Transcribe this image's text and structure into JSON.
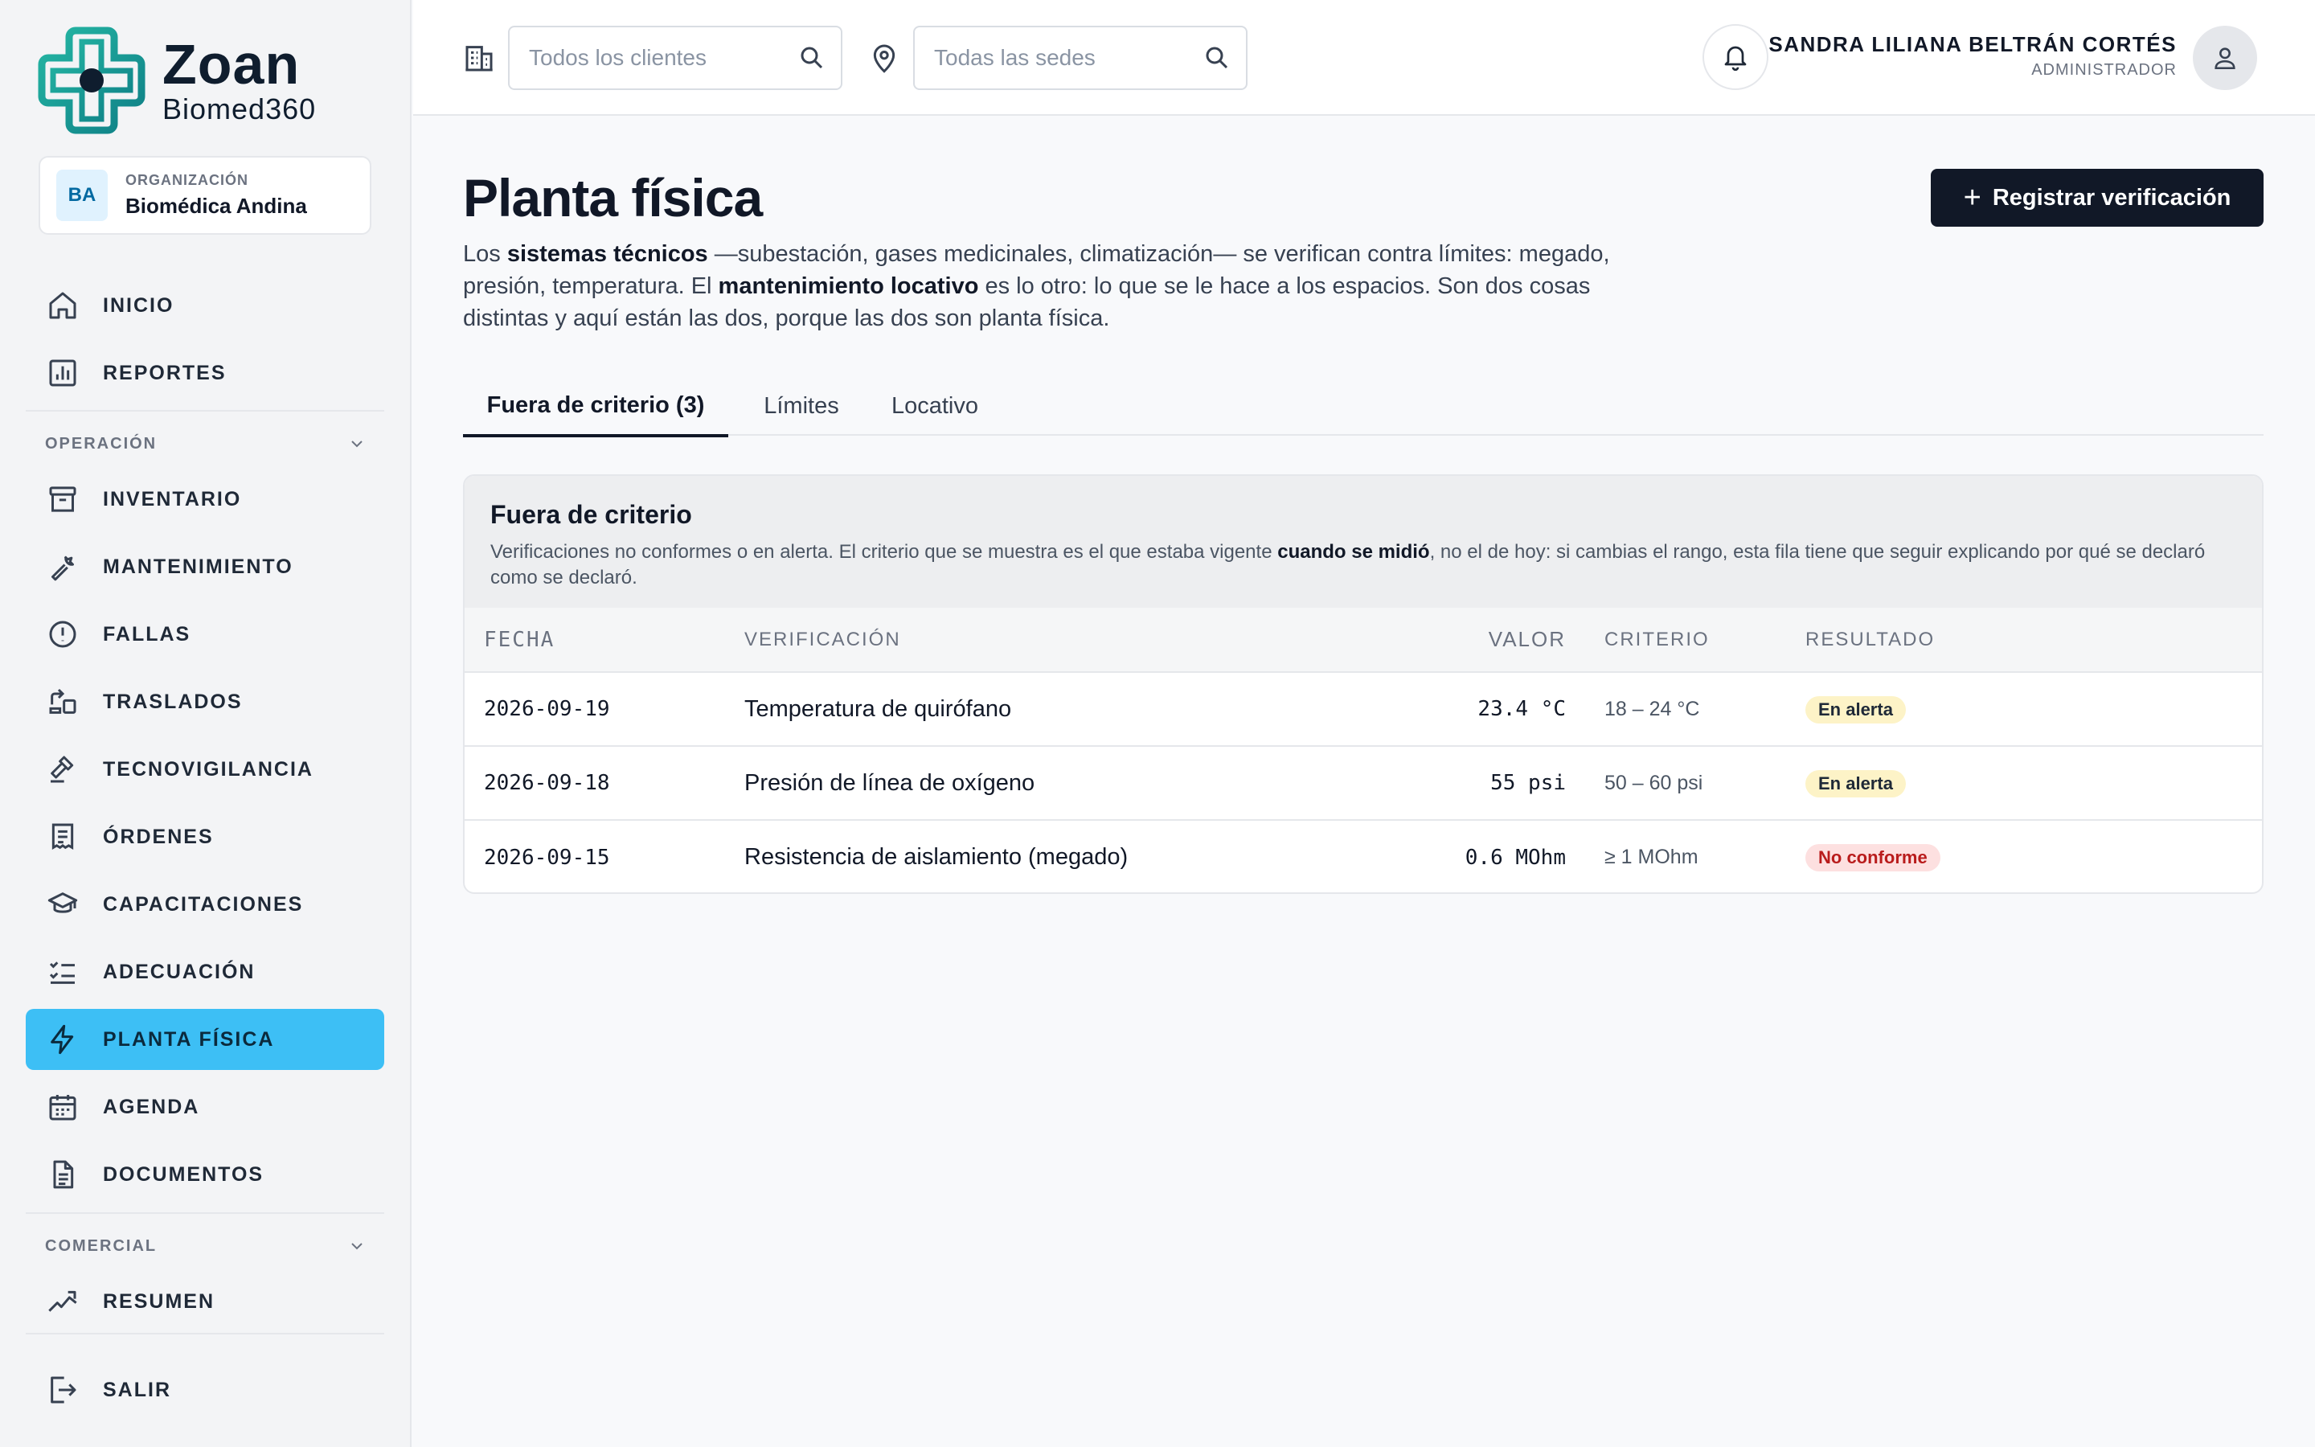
{
  "brand": {
    "name": "Zoan",
    "product": "Biomed360"
  },
  "organization": {
    "caption": "ORGANIZACIÓN",
    "initials": "BA",
    "name": "Biomédica Andina"
  },
  "nav": {
    "inicio": "INICIO",
    "reportes": "REPORTES",
    "operacion_section": "OPERACIÓN",
    "inventario": "INVENTARIO",
    "mantenimiento": "MANTENIMIENTO",
    "fallas": "FALLAS",
    "traslados": "TRASLADOS",
    "tecnovigilancia": "TECNOVIGILANCIA",
    "ordenes": "ÓRDENES",
    "capacitaciones": "CAPACITACIONES",
    "adecuacion": "ADECUACIÓN",
    "planta_fisica": "PLANTA FÍSICA",
    "agenda": "AGENDA",
    "documentos": "DOCUMENTOS",
    "comercial_section": "COMERCIAL",
    "resumen": "RESUMEN",
    "salir": "SALIR",
    "active": "planta_fisica"
  },
  "topbar": {
    "clients_placeholder": "Todos los clientes",
    "sites_placeholder": "Todas las sedes",
    "user_name": "SANDRA LILIANA BELTRÁN CORTÉS",
    "user_role": "ADMINISTRADOR"
  },
  "page": {
    "title": "Planta física",
    "intro": {
      "p1": "Los ",
      "b1": "sistemas técnicos",
      "p2": " —subestación, gases medicinales, climatización— se verifican contra límites: megado, presión, temperatura. El ",
      "b2": "mantenimiento locativo",
      "p3": " es lo otro: lo que se le hace a los espacios. Son dos cosas distintas y aquí están las dos, porque las dos son planta física."
    },
    "primary_button": "Registrar verificación"
  },
  "tabs": [
    "Fuera de criterio (3)",
    "Límites",
    "Locativo"
  ],
  "card": {
    "title": "Fuera de criterio",
    "desc_p1": "Verificaciones no conformes o en alerta. El criterio que se muestra es el que estaba vigente ",
    "desc_b": "cuando se midió",
    "desc_p2": ", no el de hoy: si cambias el rango, esta fila tiene que seguir explicando por qué se declaró como se declaró."
  },
  "table": {
    "headers": [
      "FECHA",
      "VERIFICACIÓN",
      "VALOR",
      "CRITERIO",
      "RESULTADO"
    ],
    "rows": [
      {
        "date": "2026-09-19",
        "check": "Temperatura de quirófano",
        "value": "23.4 °C",
        "criterion": "18 – 24 °C",
        "result": "En alerta",
        "status": "warn"
      },
      {
        "date": "2026-09-18",
        "check": "Presión de línea de oxígeno",
        "value": "55 psi",
        "criterion": "50 – 60 psi",
        "result": "En alerta",
        "status": "warn"
      },
      {
        "date": "2026-09-15",
        "check": "Resistencia de aislamiento (megado)",
        "value": "0.6 MOhm",
        "criterion": "≥ 1 MOhm",
        "result": "No conforme",
        "status": "bad"
      }
    ]
  },
  "colors": {
    "accent": "#3dbff5",
    "primary": "#111827",
    "brand_teal": "#1aa39a",
    "warn_bg": "#fdf3c7",
    "bad_bg": "#fde0e0",
    "bad_text": "#b91c1c"
  }
}
